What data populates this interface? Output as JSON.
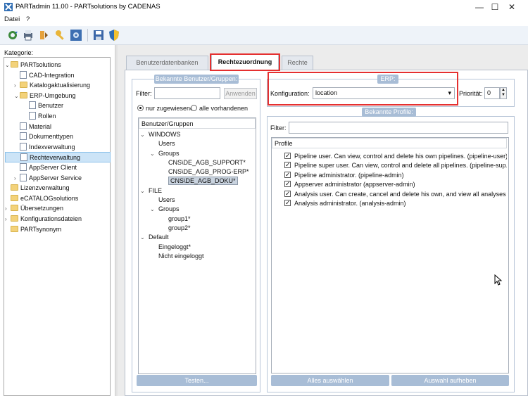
{
  "window": {
    "title": "PARTadmin 11.00 - PARTsolutions by CADENAS",
    "minimize": "—",
    "maximize": "☐",
    "close": "✕"
  },
  "menu": {
    "items": [
      "Datei",
      "?"
    ]
  },
  "toolbar": {
    "icons": [
      "refresh-icon",
      "print-icon",
      "tools-icon",
      "key-icon",
      "gear-icon",
      "save-icon",
      "shield-icon"
    ]
  },
  "left": {
    "label": "Kategorie:",
    "tree": [
      {
        "label": "PARTsolutions",
        "level": 0,
        "expander": "⌄",
        "icon": "folder"
      },
      {
        "label": "CAD-Integration",
        "level": 1,
        "expander": "",
        "icon": "doc"
      },
      {
        "label": "Katalogaktualisierung",
        "level": 1,
        "expander": "›",
        "icon": "folder"
      },
      {
        "label": "ERP-Umgebung",
        "level": 1,
        "expander": "⌄",
        "icon": "folder"
      },
      {
        "label": "Benutzer",
        "level": 2,
        "expander": "",
        "icon": "doc"
      },
      {
        "label": "Rollen",
        "level": 2,
        "expander": "",
        "icon": "doc"
      },
      {
        "label": "Material",
        "level": 1,
        "expander": "",
        "icon": "doc"
      },
      {
        "label": "Dokumenttypen",
        "level": 1,
        "expander": "",
        "icon": "doc"
      },
      {
        "label": "Indexverwaltung",
        "level": 1,
        "expander": "",
        "icon": "doc"
      },
      {
        "label": "Rechteverwaltung",
        "level": 1,
        "expander": "",
        "icon": "doc",
        "selected": true
      },
      {
        "label": "AppServer Client",
        "level": 1,
        "expander": "",
        "icon": "doc"
      },
      {
        "label": "AppServer Service",
        "level": 1,
        "expander": "›",
        "icon": "doc"
      },
      {
        "label": "Lizenzverwaltung",
        "level": 0,
        "expander": "",
        "icon": "folder"
      },
      {
        "label": "eCATALOGsolutions",
        "level": 0,
        "expander": "",
        "icon": "folder"
      },
      {
        "label": "Übersetzungen",
        "level": 0,
        "expander": "›",
        "icon": "folder"
      },
      {
        "label": "Konfigurationsdateien",
        "level": 0,
        "expander": "›",
        "icon": "folder"
      },
      {
        "label": "PARTsynonym",
        "level": 0,
        "expander": "",
        "icon": "folder"
      }
    ]
  },
  "tabs": {
    "tab1": "Benutzerdatenbanken",
    "tab2": "Rechtezuordnung",
    "tab3": "Rechte"
  },
  "users": {
    "group_title": "Bekannte Benutzer/Gruppen:",
    "filter_label": "Filter:",
    "filter_value": "",
    "apply_button": "Anwenden",
    "radio1": "nur zugewiesene",
    "radio2": "alle vorhandenen",
    "list_header": "Benutzer/Gruppen",
    "tree": [
      {
        "label": "WINDOWS",
        "level": 0,
        "expander": "⌄"
      },
      {
        "label": "Users",
        "level": 1,
        "expander": ""
      },
      {
        "label": "Groups",
        "level": 1,
        "expander": "⌄"
      },
      {
        "label": "CNS\\DE_AGB_SUPPORT*",
        "level": 2,
        "expander": ""
      },
      {
        "label": "CNS\\DE_AGB_PROG-ERP*",
        "level": 2,
        "expander": ""
      },
      {
        "label": "CNS\\DE_AGB_DOKU*",
        "level": 2,
        "expander": "",
        "selected": true
      },
      {
        "label": "FILE",
        "level": 0,
        "expander": "⌄"
      },
      {
        "label": "Users",
        "level": 1,
        "expander": ""
      },
      {
        "label": "Groups",
        "level": 1,
        "expander": "⌄"
      },
      {
        "label": "group1*",
        "level": 2,
        "expander": ""
      },
      {
        "label": "group2*",
        "level": 2,
        "expander": ""
      },
      {
        "label": "Default",
        "level": 0,
        "expander": "⌄"
      },
      {
        "label": "Eingeloggt*",
        "level": 1,
        "expander": ""
      },
      {
        "label": "Nicht eingeloggt",
        "level": 1,
        "expander": ""
      }
    ],
    "test_button": "Testen..."
  },
  "erp": {
    "group_title": "ERP:",
    "config_label": "Konfiguration:",
    "config_value": "location",
    "priority_label": "Priorität:",
    "priority_value": "0"
  },
  "profiles": {
    "group_title": "Bekannte Profile:",
    "filter_label": "Filter:",
    "filter_value": "",
    "header": "Profile",
    "items": [
      "Pipeline user. Can view, control and delete his own pipelines. (pipeline-user)",
      "Pipeline super user. Can view, control and delete all pipelines. (pipeline-sup...",
      "Pipeline administrator. (pipeline-admin)",
      "Appserver administrator (appserver-admin)",
      "Analysis user. Can create, cancel and delete his own, and view all analyses (...",
      "Analysis administrator. (analysis-admin)"
    ],
    "select_all_button": "Alles auswählen",
    "deselect_button": "Auswahl aufheben"
  },
  "colors": {
    "accent": "#a8bdd6",
    "highlight": "#e53030",
    "selection": "#cce4f7"
  }
}
